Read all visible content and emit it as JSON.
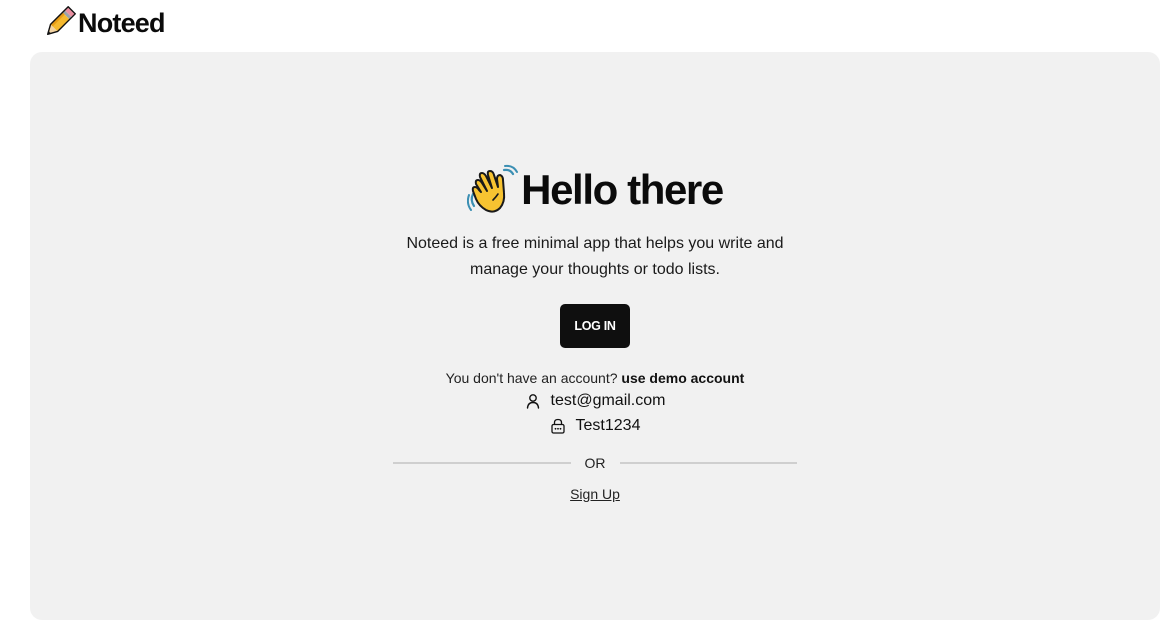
{
  "header": {
    "brand_icon": "pencil-icon",
    "brand_name": "Noteed"
  },
  "hero": {
    "icon": "waving-hand-icon",
    "title": "Hello there",
    "description_line1": "Noteed is a free minimal app that helps you write and",
    "description_line2": "manage your thoughts or todo lists."
  },
  "actions": {
    "login_label": "LOG IN"
  },
  "demo": {
    "prompt": "You don't have an account?",
    "link": "use demo account",
    "email_icon": "user-icon",
    "email": "test@gmail.com",
    "password_icon": "lock-icon",
    "password": "Test1234"
  },
  "divider": {
    "label": "OR"
  },
  "signup": {
    "label": "Sign Up"
  },
  "colors": {
    "card_background": "#f1f1f1",
    "button_background": "#0f0f0f",
    "accent_yellow": "#f7c331"
  }
}
